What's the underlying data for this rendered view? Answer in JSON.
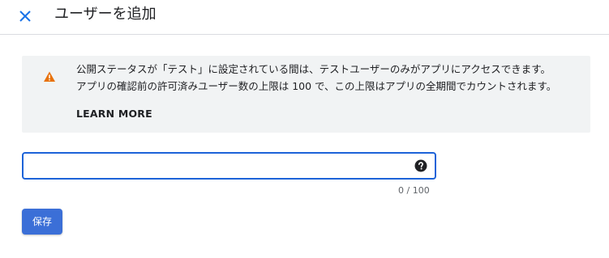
{
  "dialog": {
    "title": "ユーザーを追加",
    "close_icon": "close-icon"
  },
  "banner": {
    "icon": "warning-icon",
    "icon_color": "#e8710a",
    "line1": "公開ステータスが「テスト」に設定されている間は、テストユーザーのみがアプリにアクセスできます。",
    "line2": "アプリの確認前の許可済みユーザー数の上限は 100 で、この上限はアプリの全期間でカウントされます。",
    "learn_more": "LEARN MORE"
  },
  "input": {
    "value": "",
    "placeholder": "",
    "help_icon": "help-circle-icon",
    "counter": "0 / 100"
  },
  "actions": {
    "save_label": "保存",
    "accent_color": "#3b6fd7"
  }
}
